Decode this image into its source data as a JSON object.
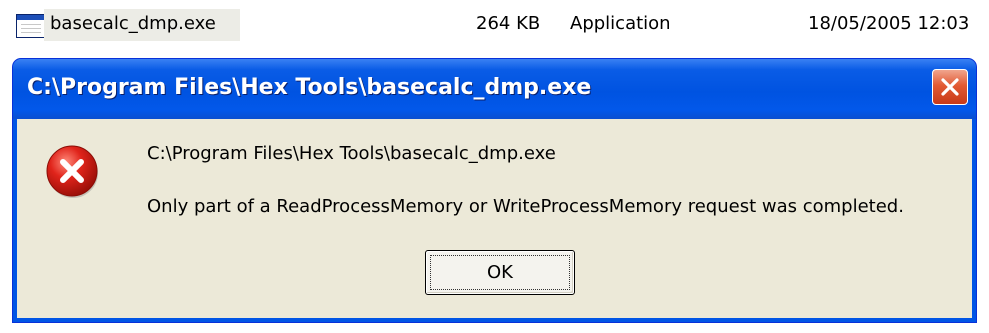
{
  "file_row": {
    "name": "basecalc_dmp.exe",
    "size": "264 KB",
    "type": "Application",
    "modified": "18/05/2005 12:03",
    "icon": "application-window-icon"
  },
  "dialog": {
    "title": "C:\\Program Files\\Hex Tools\\basecalc_dmp.exe",
    "close_icon": "close-icon",
    "message_icon": "error-icon",
    "message_path": "C:\\Program Files\\Hex Tools\\basecalc_dmp.exe",
    "message_text": "Only part of a ReadProcessMemory or WriteProcessMemory request was completed.",
    "ok_label": "OK"
  },
  "colors": {
    "titlebar": "#0055e5",
    "client": "#ece9d8",
    "close_button": "#e25a33",
    "error_red": "#e0241b"
  }
}
